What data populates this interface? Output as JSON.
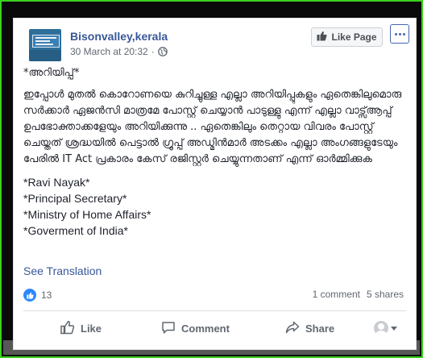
{
  "post": {
    "page_name": "Bisonvalley,kerala",
    "timestamp": "30 March at 20:32",
    "separator": "·",
    "like_page_label": "Like Page",
    "heading": "*അറിയിപ്പ്*",
    "body": "ഇപ്പോൾ മുതൽ കൊറോണയെ കുറിച്ചുള്ള എല്ലാ അറിയിപ്പുകളും ഏതെങ്കിലുമൊരു സർക്കാർ ഏജൻസി മാത്രമേ പോസ്റ്റ് ചെയ്യാൻ പാടുള്ളു എന്ന് എല്ലാ വാട്സ്ആപ്പ് ഉപഭോക്താക്കളേയും അറിയിക്കുന്നു .. ഏതെങ്കിലും തെറ്റായ വിവരം പോസ്റ്റ് ചെയ്തത് ശ്രദ്ധയിൽ പെട്ടാൽ ഗ്രൂപ്പ് അഡ്മിൻമാർ അടക്കം എല്ലാ അംഗങ്ങളുടേയും പേരിൽ IT Act പ്രകാരം കേസ് രജിസ്റ്റർ ചെയ്യുന്നതാണ് എന്ന് ഓർമ്മിക്കുക",
    "signature": [
      "*Ravi Nayak*",
      "*Principal Secretary*",
      "*Ministry of Home Affairs*",
      "*Goverment of India*"
    ],
    "see_translation": "See Translation"
  },
  "engagement": {
    "reaction_count": "13",
    "comments": "1 comment",
    "shares": "5 shares"
  },
  "actions": {
    "like": "Like",
    "comment": "Comment",
    "share": "Share"
  },
  "icons": {
    "globe": "globe-icon",
    "thumbs_up": "thumbs-up-icon",
    "comment": "comment-icon",
    "share": "share-icon",
    "more": "more-options-icon"
  },
  "colors": {
    "frame_border": "#3bd11e",
    "link_blue": "#385898",
    "like_blue": "#2d88ff"
  }
}
